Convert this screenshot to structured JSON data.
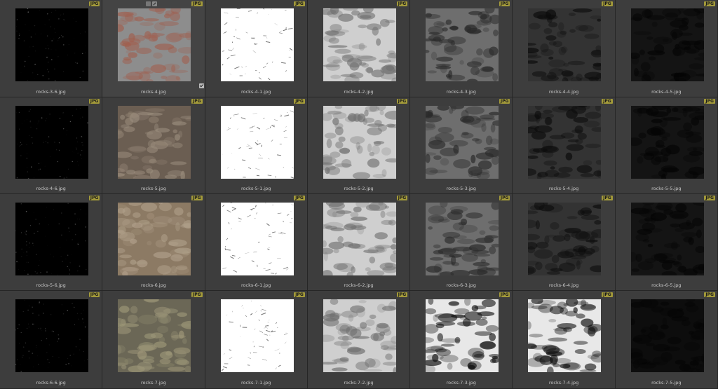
{
  "badge_label": "JPG",
  "selected_index": 1,
  "items": [
    {
      "name": "rocks-3-6.jpg",
      "tone": "dark-speckle"
    },
    {
      "name": "rocks-4.jpg",
      "tone": "color-gray-red"
    },
    {
      "name": "rocks-4-1.jpg",
      "tone": "white-lines"
    },
    {
      "name": "rocks-4-2.jpg",
      "tone": "light-gray"
    },
    {
      "name": "rocks-4-3.jpg",
      "tone": "mid-gray"
    },
    {
      "name": "rocks-4-4.jpg",
      "tone": "dark-gray"
    },
    {
      "name": "rocks-4-5.jpg",
      "tone": "very-dark"
    },
    {
      "name": "rocks-4-6.jpg",
      "tone": "dark-speckle"
    },
    {
      "name": "rocks-5.jpg",
      "tone": "color-brown"
    },
    {
      "name": "rocks-5-1.jpg",
      "tone": "white-lines"
    },
    {
      "name": "rocks-5-2.jpg",
      "tone": "light-gray"
    },
    {
      "name": "rocks-5-3.jpg",
      "tone": "mid-gray"
    },
    {
      "name": "rocks-5-4.jpg",
      "tone": "dark-gray"
    },
    {
      "name": "rocks-5-5.jpg",
      "tone": "very-dark"
    },
    {
      "name": "rocks-5-6.jpg",
      "tone": "dark-speckle"
    },
    {
      "name": "rocks-6.jpg",
      "tone": "color-tan"
    },
    {
      "name": "rocks-6-1.jpg",
      "tone": "white-lines"
    },
    {
      "name": "rocks-6-2.jpg",
      "tone": "light-gray"
    },
    {
      "name": "rocks-6-3.jpg",
      "tone": "mid-gray"
    },
    {
      "name": "rocks-6-4.jpg",
      "tone": "dark-gray"
    },
    {
      "name": "rocks-6-5.jpg",
      "tone": "very-dark"
    },
    {
      "name": "rocks-6-6.jpg",
      "tone": "dark-speckle"
    },
    {
      "name": "rocks-7.jpg",
      "tone": "color-olive"
    },
    {
      "name": "rocks-7-1.jpg",
      "tone": "white-lines"
    },
    {
      "name": "rocks-7-2.jpg",
      "tone": "light-gray"
    },
    {
      "name": "rocks-7-3.jpg",
      "tone": "contrast-bw"
    },
    {
      "name": "rocks-7-4.jpg",
      "tone": "contrast-bw"
    },
    {
      "name": "rocks-7-5.jpg",
      "tone": "near-black"
    }
  ],
  "icons": {
    "selection_top": [
      "frame-icon",
      "pencil-icon"
    ],
    "selection_bottom": "checkbox-checked-icon"
  },
  "tone_colors": {
    "dark-speckle": [
      "#000000",
      "#5a5a5a"
    ],
    "color-gray-red": [
      "#8d8d8d",
      "#a06050"
    ],
    "color-brown": [
      "#6b5e52",
      "#9a8c7c"
    ],
    "color-tan": [
      "#8c7a64",
      "#b0a08a"
    ],
    "color-olive": [
      "#6b6756",
      "#9c9678"
    ],
    "white-lines": [
      "#ffffff",
      "#3a3a3a"
    ],
    "light-gray": [
      "#cfcfcf",
      "#707070"
    ],
    "mid-gray": [
      "#6e6e6e",
      "#2a2a2a"
    ],
    "dark-gray": [
      "#333333",
      "#0c0c0c"
    ],
    "very-dark": [
      "#141414",
      "#050505"
    ],
    "contrast-bw": [
      "#e8e8e8",
      "#0a0a0a"
    ],
    "near-black": [
      "#0d0d0d",
      "#050505"
    ]
  }
}
